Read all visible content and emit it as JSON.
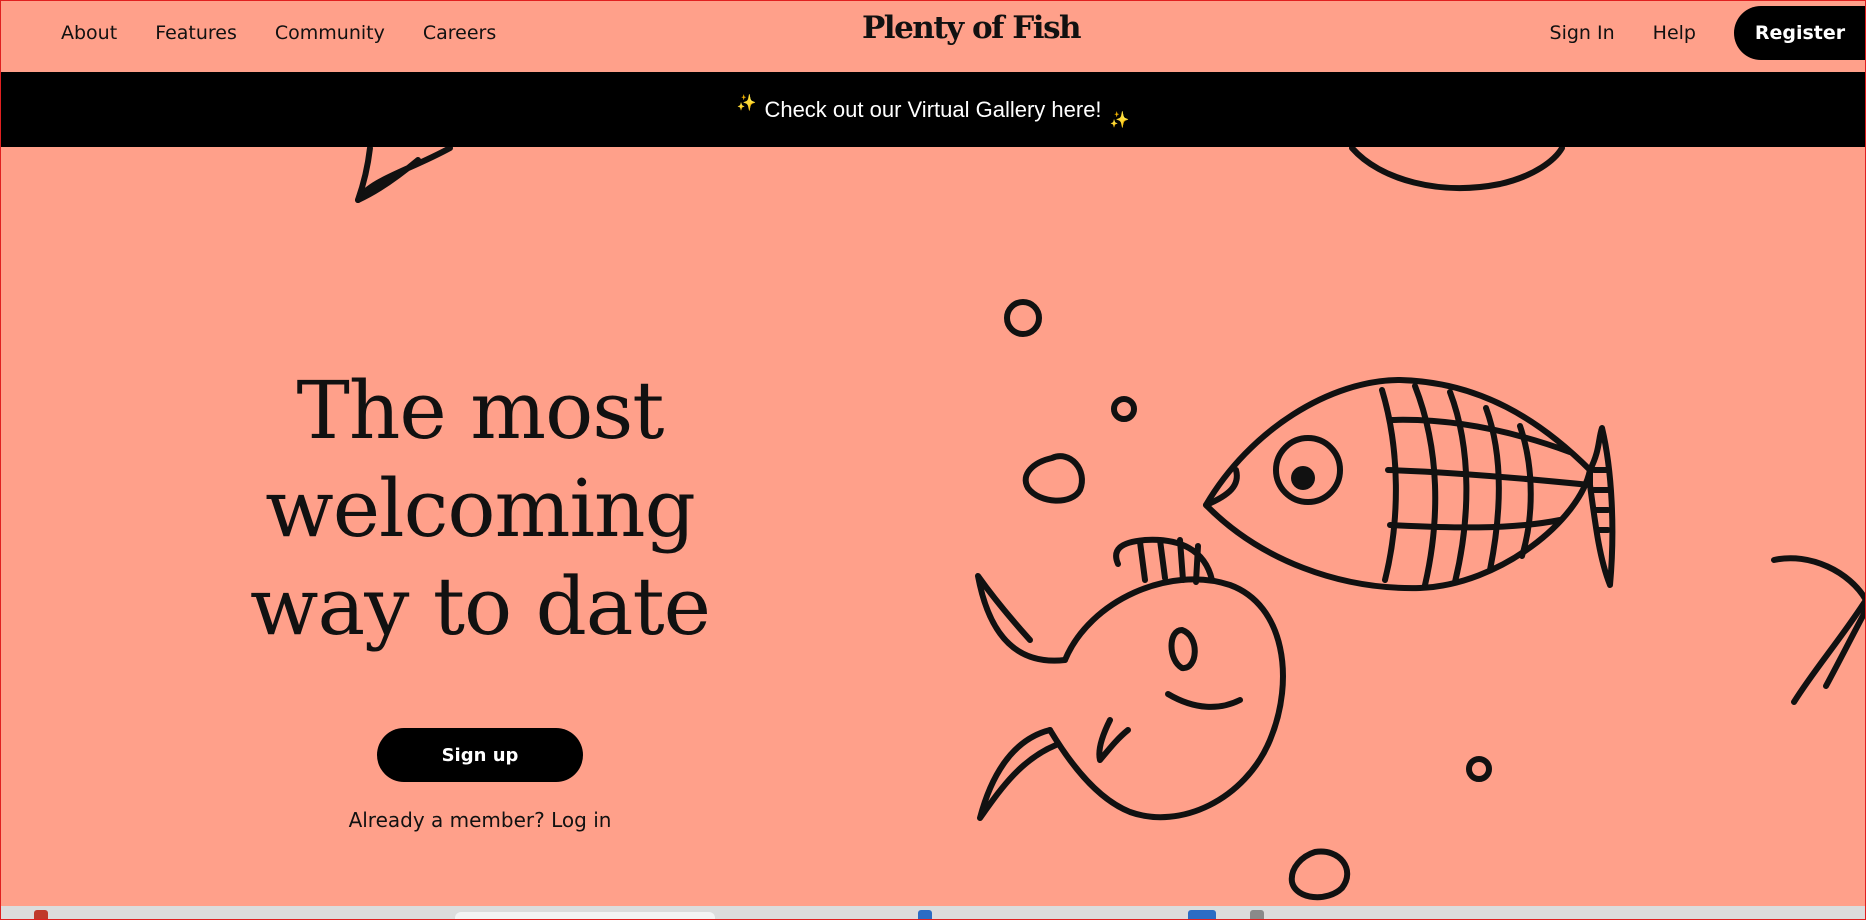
{
  "nav": {
    "left_links": [
      "About",
      "Features",
      "Community",
      "Careers"
    ],
    "logo": "Plenty of Fish",
    "sign_in": "Sign In",
    "help": "Help",
    "register": "Register"
  },
  "banner": {
    "text": "Check out our Virtual Gallery here!",
    "sparkle": "✨"
  },
  "hero": {
    "heading_lines": [
      "The most",
      "welcoming",
      "way to date"
    ],
    "signup": "Sign up",
    "member_prompt": "Already a member?",
    "login": "Log in"
  },
  "colors": {
    "background": "#ffa08a",
    "banner": "#000000",
    "button": "#000000",
    "text": "#111111"
  }
}
